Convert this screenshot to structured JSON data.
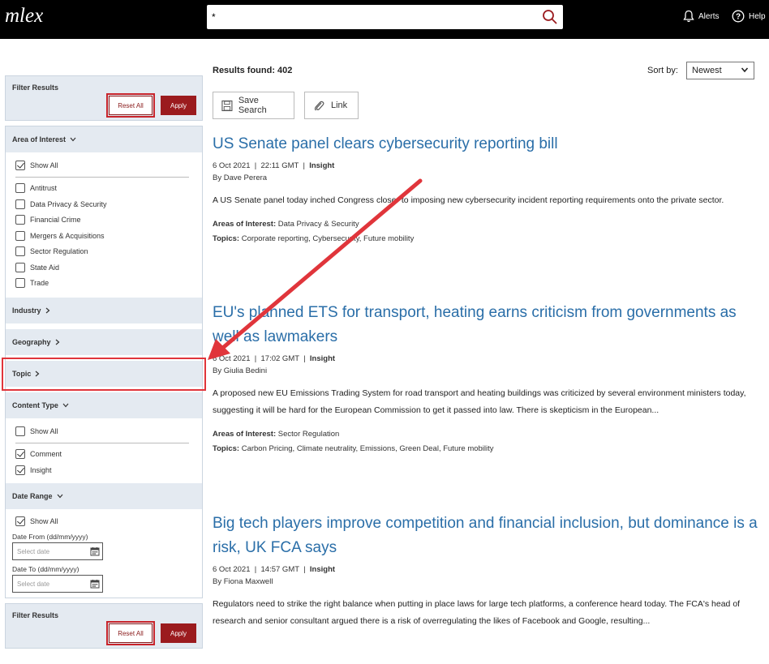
{
  "header": {
    "logo": "mlex",
    "search_value": "*",
    "alerts_label": "Alerts",
    "help_label": "Help"
  },
  "filters": {
    "title": "Filter Results",
    "reset_label": "Reset All",
    "apply_label": "Apply",
    "area_of_interest": {
      "label": "Area of Interest",
      "show_all": "Show All",
      "items": [
        "Antitrust",
        "Data Privacy & Security",
        "Financial Crime",
        "Mergers & Acquisitions",
        "Sector Regulation",
        "State Aid",
        "Trade"
      ]
    },
    "industry_label": "Industry",
    "geography_label": "Geography",
    "topic_label": "Topic",
    "content_type": {
      "label": "Content Type",
      "show_all": "Show All",
      "items": [
        "Comment",
        "Insight"
      ]
    },
    "date_range": {
      "label": "Date Range",
      "show_all": "Show All",
      "from_label": "Date From (dd/mm/yyyy)",
      "to_label": "Date To (dd/mm/yyyy)",
      "placeholder": "Select date"
    }
  },
  "results": {
    "count_text": "Results found: 402",
    "sort_label": "Sort by:",
    "sort_value": "Newest",
    "save_search_label": "Save Search",
    "link_label": "Link"
  },
  "articles": [
    {
      "title": "US Senate panel clears cybersecurity reporting bill",
      "date": "6 Oct 2021",
      "time": "22:11 GMT",
      "type": "Insight",
      "author": "By Dave Perera",
      "summary": "A US Senate panel today inched Congress closer to imposing new cybersecurity incident reporting requirements onto the private sector.",
      "areas_label": "Areas of Interest:",
      "areas": "Data Privacy & Security",
      "topics_label": "Topics:",
      "topics": "Corporate reporting, Cybersecurity, Future mobility"
    },
    {
      "title": "EU's planned ETS for transport, heating earns criticism from governments as well as lawmakers",
      "date": "6 Oct 2021",
      "time": "17:02 GMT",
      "type": "Insight",
      "author": "By Giulia Bedini",
      "summary": "A proposed new EU Emissions Trading System for road transport and heating buildings was criticized by several environment ministers today, suggesting it will be hard for the European Commission to get it passed into law. There is skepticism in the European...",
      "areas_label": "Areas of Interest:",
      "areas": "Sector Regulation",
      "topics_label": "Topics:",
      "topics": "Carbon Pricing, Climate neutrality, Emissions, Green Deal, Future mobility"
    },
    {
      "title": "Big tech players improve competition and financial inclusion, but dominance is a risk, UK FCA says",
      "date": "6 Oct 2021",
      "time": "14:57 GMT",
      "type": "Insight",
      "author": "By Fiona Maxwell",
      "summary": "Regulators need to strike the right balance when putting in place laws for large tech platforms, a conference heard today. The FCA's head of research and senior consultant argued there is a risk of overregulating the likes of Facebook and Google, resulting..."
    }
  ],
  "colors": {
    "header_bg": "#000000",
    "link_blue": "#2a6ea8",
    "apply_red": "#9b1b1e",
    "annotation_red": "#e0353b",
    "panel_bg": "#e4eaf1"
  }
}
